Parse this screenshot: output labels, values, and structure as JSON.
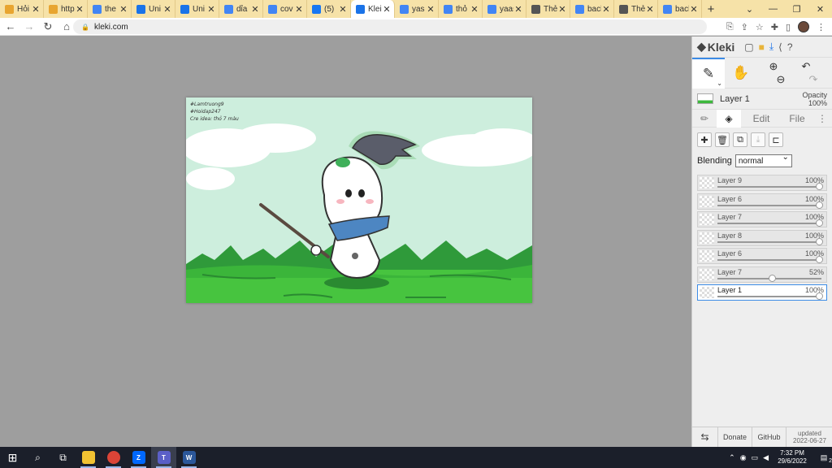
{
  "browser": {
    "tabs": [
      {
        "label": "Hỏi",
        "icon": "hoidap-icon",
        "color": "#e8a530"
      },
      {
        "label": "http",
        "icon": "hoidap-icon",
        "color": "#e8a530"
      },
      {
        "label": "the",
        "icon": "google-icon",
        "color": "#4285f4"
      },
      {
        "label": "Uni",
        "icon": "unsplash-icon",
        "color": "#1a73e8"
      },
      {
        "label": "Uni",
        "icon": "unsplash-icon",
        "color": "#1a73e8"
      },
      {
        "label": "dỉa",
        "icon": "google-icon",
        "color": "#4285f4"
      },
      {
        "label": "cov",
        "icon": "google-icon",
        "color": "#4285f4"
      },
      {
        "label": "(5)",
        "icon": "facebook-icon",
        "color": "#1877f2"
      },
      {
        "label": "Klei",
        "icon": "kleki-icon",
        "color": "#1a73e8"
      },
      {
        "label": "yas",
        "icon": "google-icon",
        "color": "#4285f4"
      },
      {
        "label": "thỏ 7 m",
        "icon": "google-icon",
        "color": "#4285f4"
      },
      {
        "label": "yaasuo",
        "icon": "google-icon",
        "color": "#4285f4"
      },
      {
        "label": "Thẻ mớ",
        "icon": "chrome-icon",
        "color": "#555555"
      },
      {
        "label": "backgro",
        "icon": "google-icon",
        "color": "#4285f4"
      },
      {
        "label": "Thẻ mớ",
        "icon": "chrome-icon",
        "color": "#555555"
      },
      {
        "label": "backgro",
        "icon": "google-icon",
        "color": "#4285f4"
      }
    ],
    "active_tab": 8,
    "url": "kleki.com"
  },
  "canvas": {
    "watermark_lines": [
      "#Lamtruong9",
      "#Hoidap247",
      "Cre idea: thỏ 7 màu"
    ]
  },
  "panel": {
    "logo": "Kleki",
    "current_layer": {
      "name": "Layer 1",
      "opacity_label": "Opacity",
      "opacity_value": "100%"
    },
    "tabs": {
      "edit": "Edit",
      "file": "File"
    },
    "blending_label": "Blending",
    "blending_value": "normal",
    "layers": [
      {
        "name": "Layer 9",
        "opacity": "100%",
        "level": 1.0,
        "selected": false
      },
      {
        "name": "Layer 6",
        "opacity": "100%",
        "level": 1.0,
        "selected": false
      },
      {
        "name": "Layer 7",
        "opacity": "100%",
        "level": 1.0,
        "selected": false
      },
      {
        "name": "Layer 8",
        "opacity": "100%",
        "level": 1.0,
        "selected": false
      },
      {
        "name": "Layer 6",
        "opacity": "100%",
        "level": 1.0,
        "selected": false
      },
      {
        "name": "Layer 7",
        "opacity": "52%",
        "level": 0.52,
        "selected": false
      },
      {
        "name": "Layer 1",
        "opacity": "100%",
        "level": 1.0,
        "selected": true
      }
    ],
    "footer": {
      "donate": "Donate",
      "github": "GitHub",
      "updated_label": "updated",
      "updated_date": "2022-06-27"
    }
  },
  "taskbar": {
    "time": "7:32 PM",
    "date": "29/6/2022",
    "notification_count": "2"
  }
}
